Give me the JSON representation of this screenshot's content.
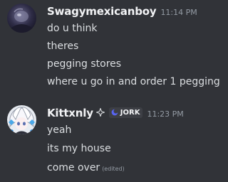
{
  "messages": [
    {
      "username": "Swagymexicanboy",
      "timestamp": "11:14 PM",
      "lines": [
        "do u think",
        "theres",
        "pegging stores",
        "where u go in and order 1 pegging"
      ]
    },
    {
      "username": "Kittxnly",
      "timestamp": "11:23 PM",
      "tag": "JORK",
      "lines": [
        "yeah",
        "its my house",
        "come over"
      ],
      "edited_label": "(edited)"
    }
  ],
  "colors": {
    "background": "#313338",
    "username": "#f2f3f5",
    "text": "#dbdee1",
    "muted": "#949ba4",
    "tag_bg": "#3d3f45",
    "tag_icon": "#5865f2"
  },
  "icons": {
    "badge": "sparkle-diamond-icon",
    "tag": "guild-tag-icon"
  }
}
